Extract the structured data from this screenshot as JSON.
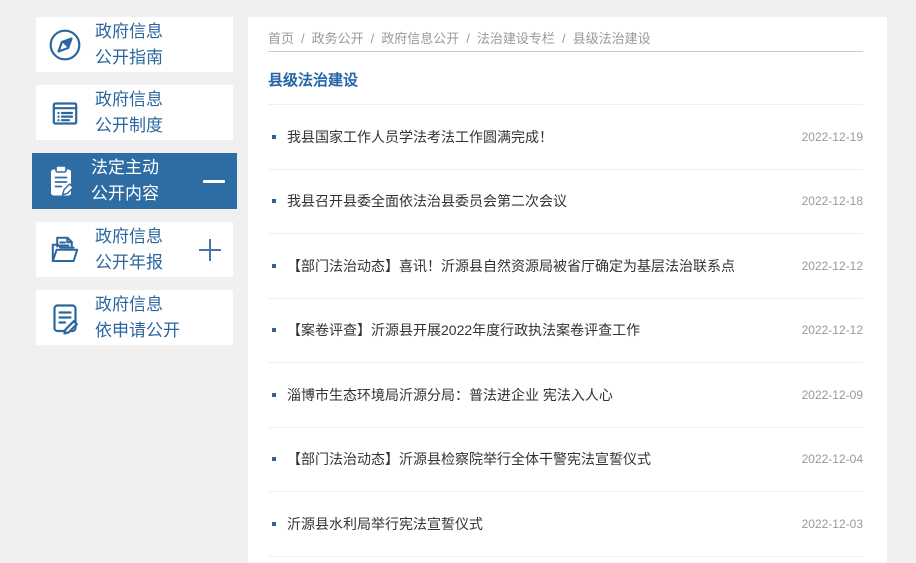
{
  "colors": {
    "page_bg": "#f0f0f0",
    "panel_bg": "#ffffff",
    "accent_blue": "#2e6da4",
    "sidebar_text": "#2b679e",
    "title_blue": "#2464a8",
    "article_text": "#333333",
    "muted_text": "#999999",
    "breadcrumb_border": "#cccccc",
    "row_border": "#f0efef",
    "bullet": "#3a5f8c",
    "plus_color": "#4a74a4"
  },
  "sidebar": {
    "items": [
      {
        "key": "gov-info-guide",
        "icon": "compass-icon",
        "label_line1": "政府信息",
        "label_line2": "公开指南",
        "active": false,
        "expand": ""
      },
      {
        "key": "gov-info-system",
        "icon": "document-list-icon",
        "label_line1": "政府信息",
        "label_line2": "公开制度",
        "active": false,
        "expand": ""
      },
      {
        "key": "statutory-active",
        "icon": "clipboard-pen-icon",
        "label_line1": "法定主动",
        "label_line2": "公开内容",
        "active": true,
        "expand": "minus"
      },
      {
        "key": "annual-report",
        "icon": "folder-doc-icon",
        "label_line1": "政府信息",
        "label_line2": "公开年报",
        "active": false,
        "expand": "plus"
      },
      {
        "key": "on-request",
        "icon": "doc-pen-icon",
        "label_line1": "政府信息",
        "label_line2": "依申请公开",
        "active": false,
        "expand": ""
      }
    ]
  },
  "breadcrumb": {
    "separator": "/",
    "items": [
      "首页",
      "政务公开",
      "政府信息公开",
      "法治建设专栏",
      "县级法治建设"
    ]
  },
  "main": {
    "title": "县级法治建设",
    "articles": [
      {
        "title": "我县国家工作人员学法考法工作圆满完成！",
        "date": "2022-12-19"
      },
      {
        "title": "我县召开县委全面依法治县委员会第二次会议",
        "date": "2022-12-18"
      },
      {
        "title": "【部门法治动态】喜讯！沂源县自然资源局被省厅确定为基层法治联系点",
        "date": "2022-12-12"
      },
      {
        "title": "【案卷评查】沂源县开展2022年度行政执法案卷评查工作",
        "date": "2022-12-12"
      },
      {
        "title": "淄博市生态环境局沂源分局：普法进企业 宪法入人心",
        "date": "2022-12-09"
      },
      {
        "title": "【部门法治动态】沂源县检察院举行全体干警宪法宣誓仪式",
        "date": "2022-12-04"
      },
      {
        "title": "沂源县水利局举行宪法宣誓仪式",
        "date": "2022-12-03"
      }
    ]
  }
}
